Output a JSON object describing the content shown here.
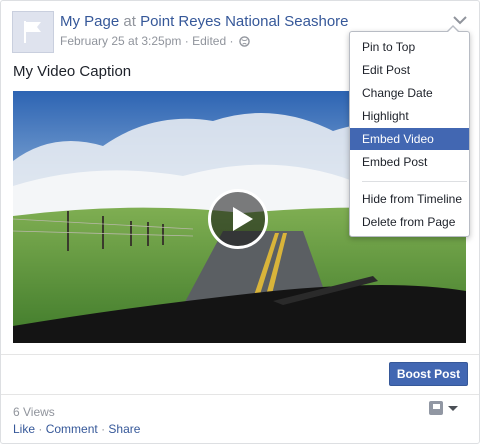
{
  "post": {
    "page_name": "My Page",
    "at_text": "at",
    "place": "Point Reyes National Seashore",
    "date": "February 25 at 3:25pm",
    "separator": "·",
    "edited": "Edited",
    "caption": "My Video Caption"
  },
  "menu": {
    "items": [
      {
        "label": "Pin to Top"
      },
      {
        "label": "Edit Post"
      },
      {
        "label": "Change Date"
      },
      {
        "label": "Highlight"
      },
      {
        "label": "Embed Video",
        "active": true
      },
      {
        "label": "Embed Post"
      },
      {
        "label": "Hide from Timeline"
      },
      {
        "label": "Delete from Page"
      }
    ]
  },
  "boost_label": "Boost Post",
  "stats": {
    "views": "6 Views"
  },
  "actions": {
    "like": "Like",
    "comment": "Comment",
    "share": "Share",
    "dot": "·"
  },
  "colors": {
    "link": "#365899",
    "accent": "#4267b2",
    "muted": "#90949c"
  },
  "icons": [
    "flag-icon",
    "globe-icon",
    "chevron-down-icon",
    "play-icon",
    "page-flag-icon",
    "caret-down-icon"
  ]
}
